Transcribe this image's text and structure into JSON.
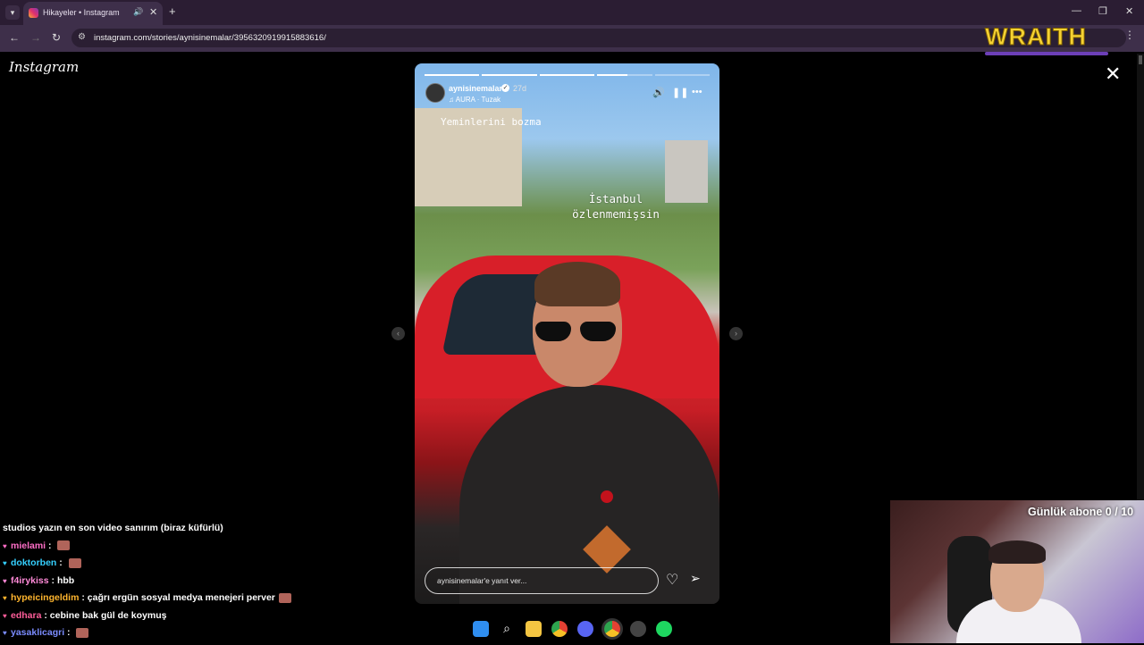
{
  "browser": {
    "tab_title": "Hikayeler • Instagram",
    "url": "instagram.com/stories/aynisinemalar/3956320919915883616/",
    "new_tab_label": "+",
    "window_controls": [
      "minimize-icon",
      "restore-icon",
      "close-icon"
    ]
  },
  "overlay": {
    "wraith_logo": "WRAITH"
  },
  "instagram": {
    "logo": "Instagram",
    "close_label": "✕"
  },
  "story": {
    "username": "aynisinemalar",
    "time": "27d",
    "music": "AURA · Tuzak",
    "progress": [
      1,
      1,
      1,
      0.55,
      0
    ],
    "caption_top": "Yeminlerini bozma",
    "caption_mid": "İstanbul özlenmemişsin",
    "reply_placeholder": "aynisinemalar'e yanıt ver..."
  },
  "chat": {
    "messages": [
      {
        "user": "",
        "text": "studios yazın en son video sanırım (biraz küfürlü)",
        "color": "#ffffff",
        "emote": false
      },
      {
        "user": "mielami",
        "text": "",
        "color": "#ff6ec7",
        "emote": true
      },
      {
        "user": "doktorben",
        "text": "",
        "color": "#35d0ff",
        "emote": true
      },
      {
        "user": "f4irykiss",
        "text": "hbb",
        "color": "#ff8ad8",
        "emote": false
      },
      {
        "user": "hypeicingeldim",
        "text": "çağrı ergün sosyal medya menejeri perver",
        "color": "#ffb52e",
        "emote": true
      },
      {
        "user": "edhara",
        "text": "cebine bak gül de koymuş",
        "color": "#ff5e9a",
        "emote": false
      },
      {
        "user": "yasaklicagri",
        "text": "",
        "color": "#7b8cff",
        "emote": true
      }
    ]
  },
  "stream": {
    "sub_goal": "Günlük abone 0 / 10"
  },
  "taskbar": {
    "apps": [
      "windows-start-icon",
      "search-icon",
      "file-explorer-icon",
      "chrome-icon",
      "discord-icon",
      "chrome-active-icon",
      "obs-icon",
      "spotify-icon"
    ]
  }
}
